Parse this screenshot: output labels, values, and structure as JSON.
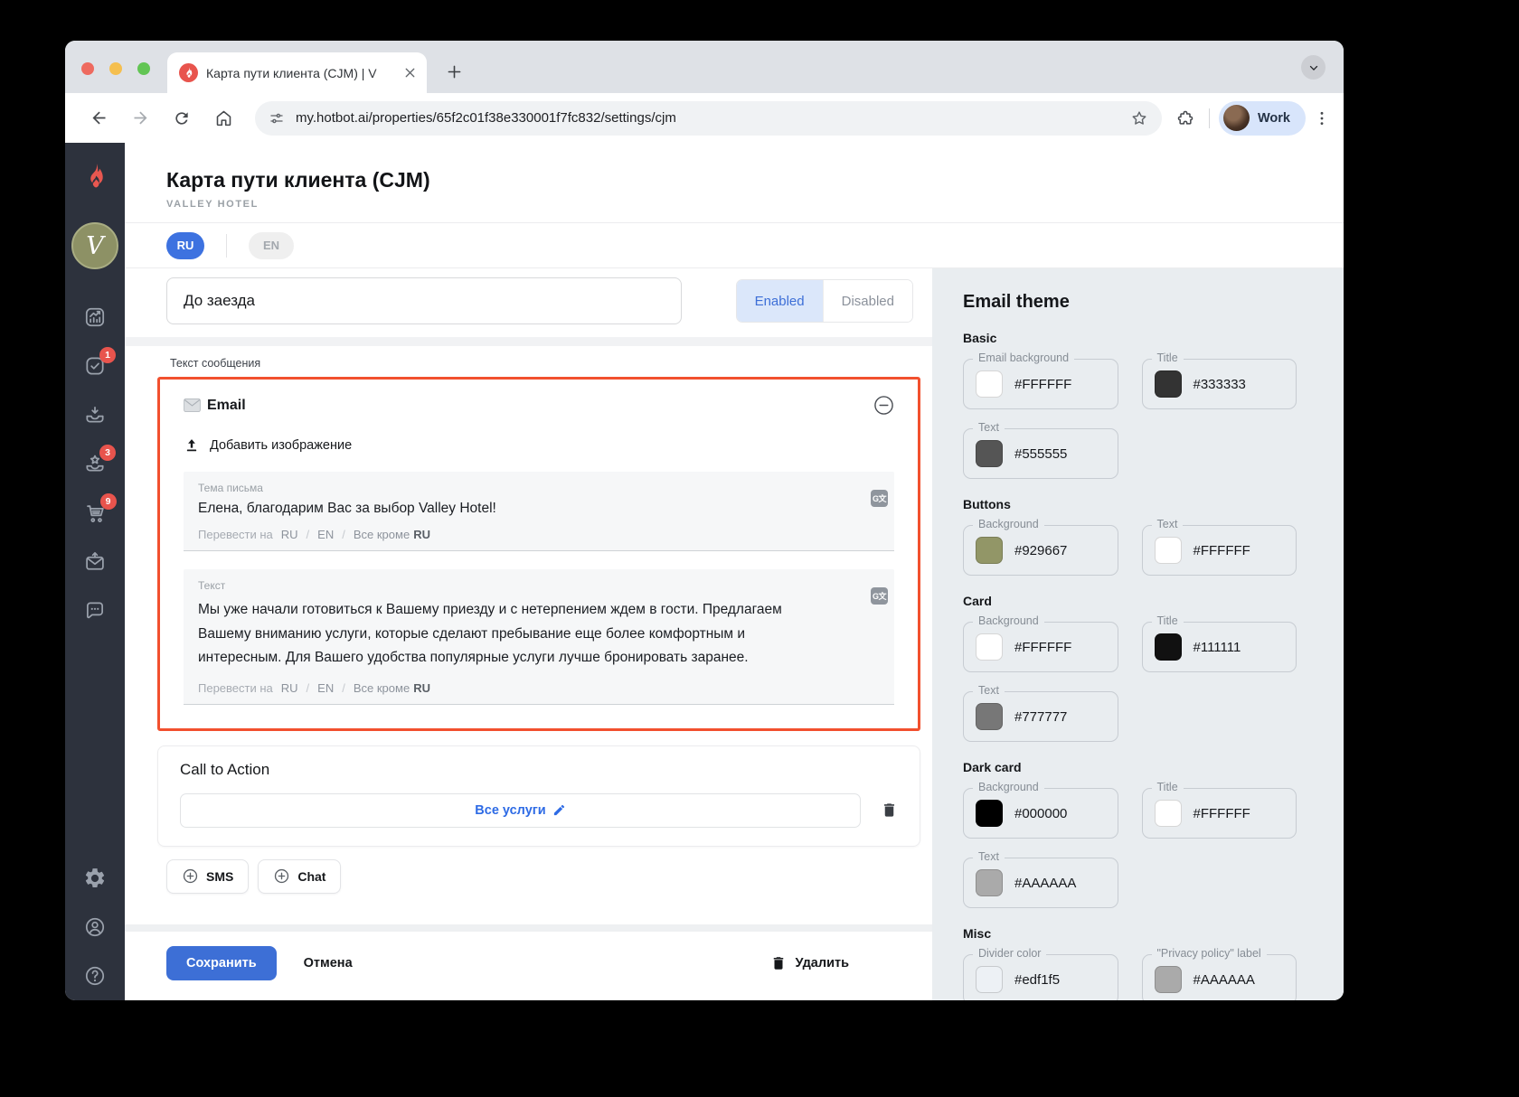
{
  "browser": {
    "tab_title": "Карта пути клиента (CJM) | V",
    "url": "my.hotbot.ai/properties/65f2c01f38e330001f7fc832/settings/cjm",
    "profile_label": "Work"
  },
  "sidebar": {
    "badges": {
      "tasks": "1",
      "star": "3",
      "cart": "9"
    }
  },
  "page": {
    "title": "Карта пути клиента (CJM)",
    "subtitle": "VALLEY HOTEL",
    "lang_ru": "RU",
    "lang_en": "EN"
  },
  "form": {
    "stage_name": "До заезда",
    "enabled_label": "Enabled",
    "disabled_label": "Disabled",
    "message_label": "Текст сообщения",
    "email": {
      "header": "Email",
      "add_image": "Добавить изображение",
      "subject_label": "Тема письма",
      "subject_value": "Елена, благодарим Вас за выбор Valley Hotel!",
      "body_label": "Текст",
      "body_value": "Мы уже начали готовиться к Вашему приезду и с нетерпением ждем в гости. Предлагаем Вашему вниманию услуги, которые сделают пребывание еще более комфортным и интересным. Для Вашего удобства популярные услуги лучше бронировать заранее.",
      "translate_prefix": "Перевести на",
      "translate_ru": "RU",
      "translate_en": "EN",
      "translate_all_except": "Все кроме",
      "translate_all_except_bold": "RU",
      "translate_icon_glyph": "G文"
    },
    "cta": {
      "heading": "Call to Action",
      "link": "Все услуги"
    },
    "add_sms": "SMS",
    "add_chat": "Chat",
    "save": "Сохранить",
    "cancel": "Отмена",
    "delete": "Удалить"
  },
  "theme_panel": {
    "title": "Email theme",
    "sections": [
      {
        "name": "Basic",
        "fields": [
          {
            "label": "Email background",
            "hex": "#FFFFFF"
          },
          {
            "label": "Title",
            "hex": "#333333"
          },
          {
            "label": "Text",
            "hex": "#555555"
          }
        ]
      },
      {
        "name": "Buttons",
        "fields": [
          {
            "label": "Background",
            "hex": "#929667"
          },
          {
            "label": "Text",
            "hex": "#FFFFFF"
          }
        ]
      },
      {
        "name": "Card",
        "fields": [
          {
            "label": "Background",
            "hex": "#FFFFFF"
          },
          {
            "label": "Title",
            "hex": "#111111"
          },
          {
            "label": "Text",
            "hex": "#777777"
          }
        ]
      },
      {
        "name": "Dark card",
        "fields": [
          {
            "label": "Background",
            "hex": "#000000"
          },
          {
            "label": "Title",
            "hex": "#FFFFFF"
          },
          {
            "label": "Text",
            "hex": "#AAAAAA"
          }
        ]
      },
      {
        "name": "Misc",
        "fields": [
          {
            "label": "Divider color",
            "hex": "#edf1f5"
          },
          {
            "label": "\"Privacy policy\" label",
            "hex": "#AAAAAA"
          }
        ]
      }
    ]
  },
  "colors": {
    "accent_blue": "#3d6fd6",
    "highlight_red_border": "#f2502e",
    "badge_red": "#e8544d",
    "button_olive": "#929667"
  }
}
